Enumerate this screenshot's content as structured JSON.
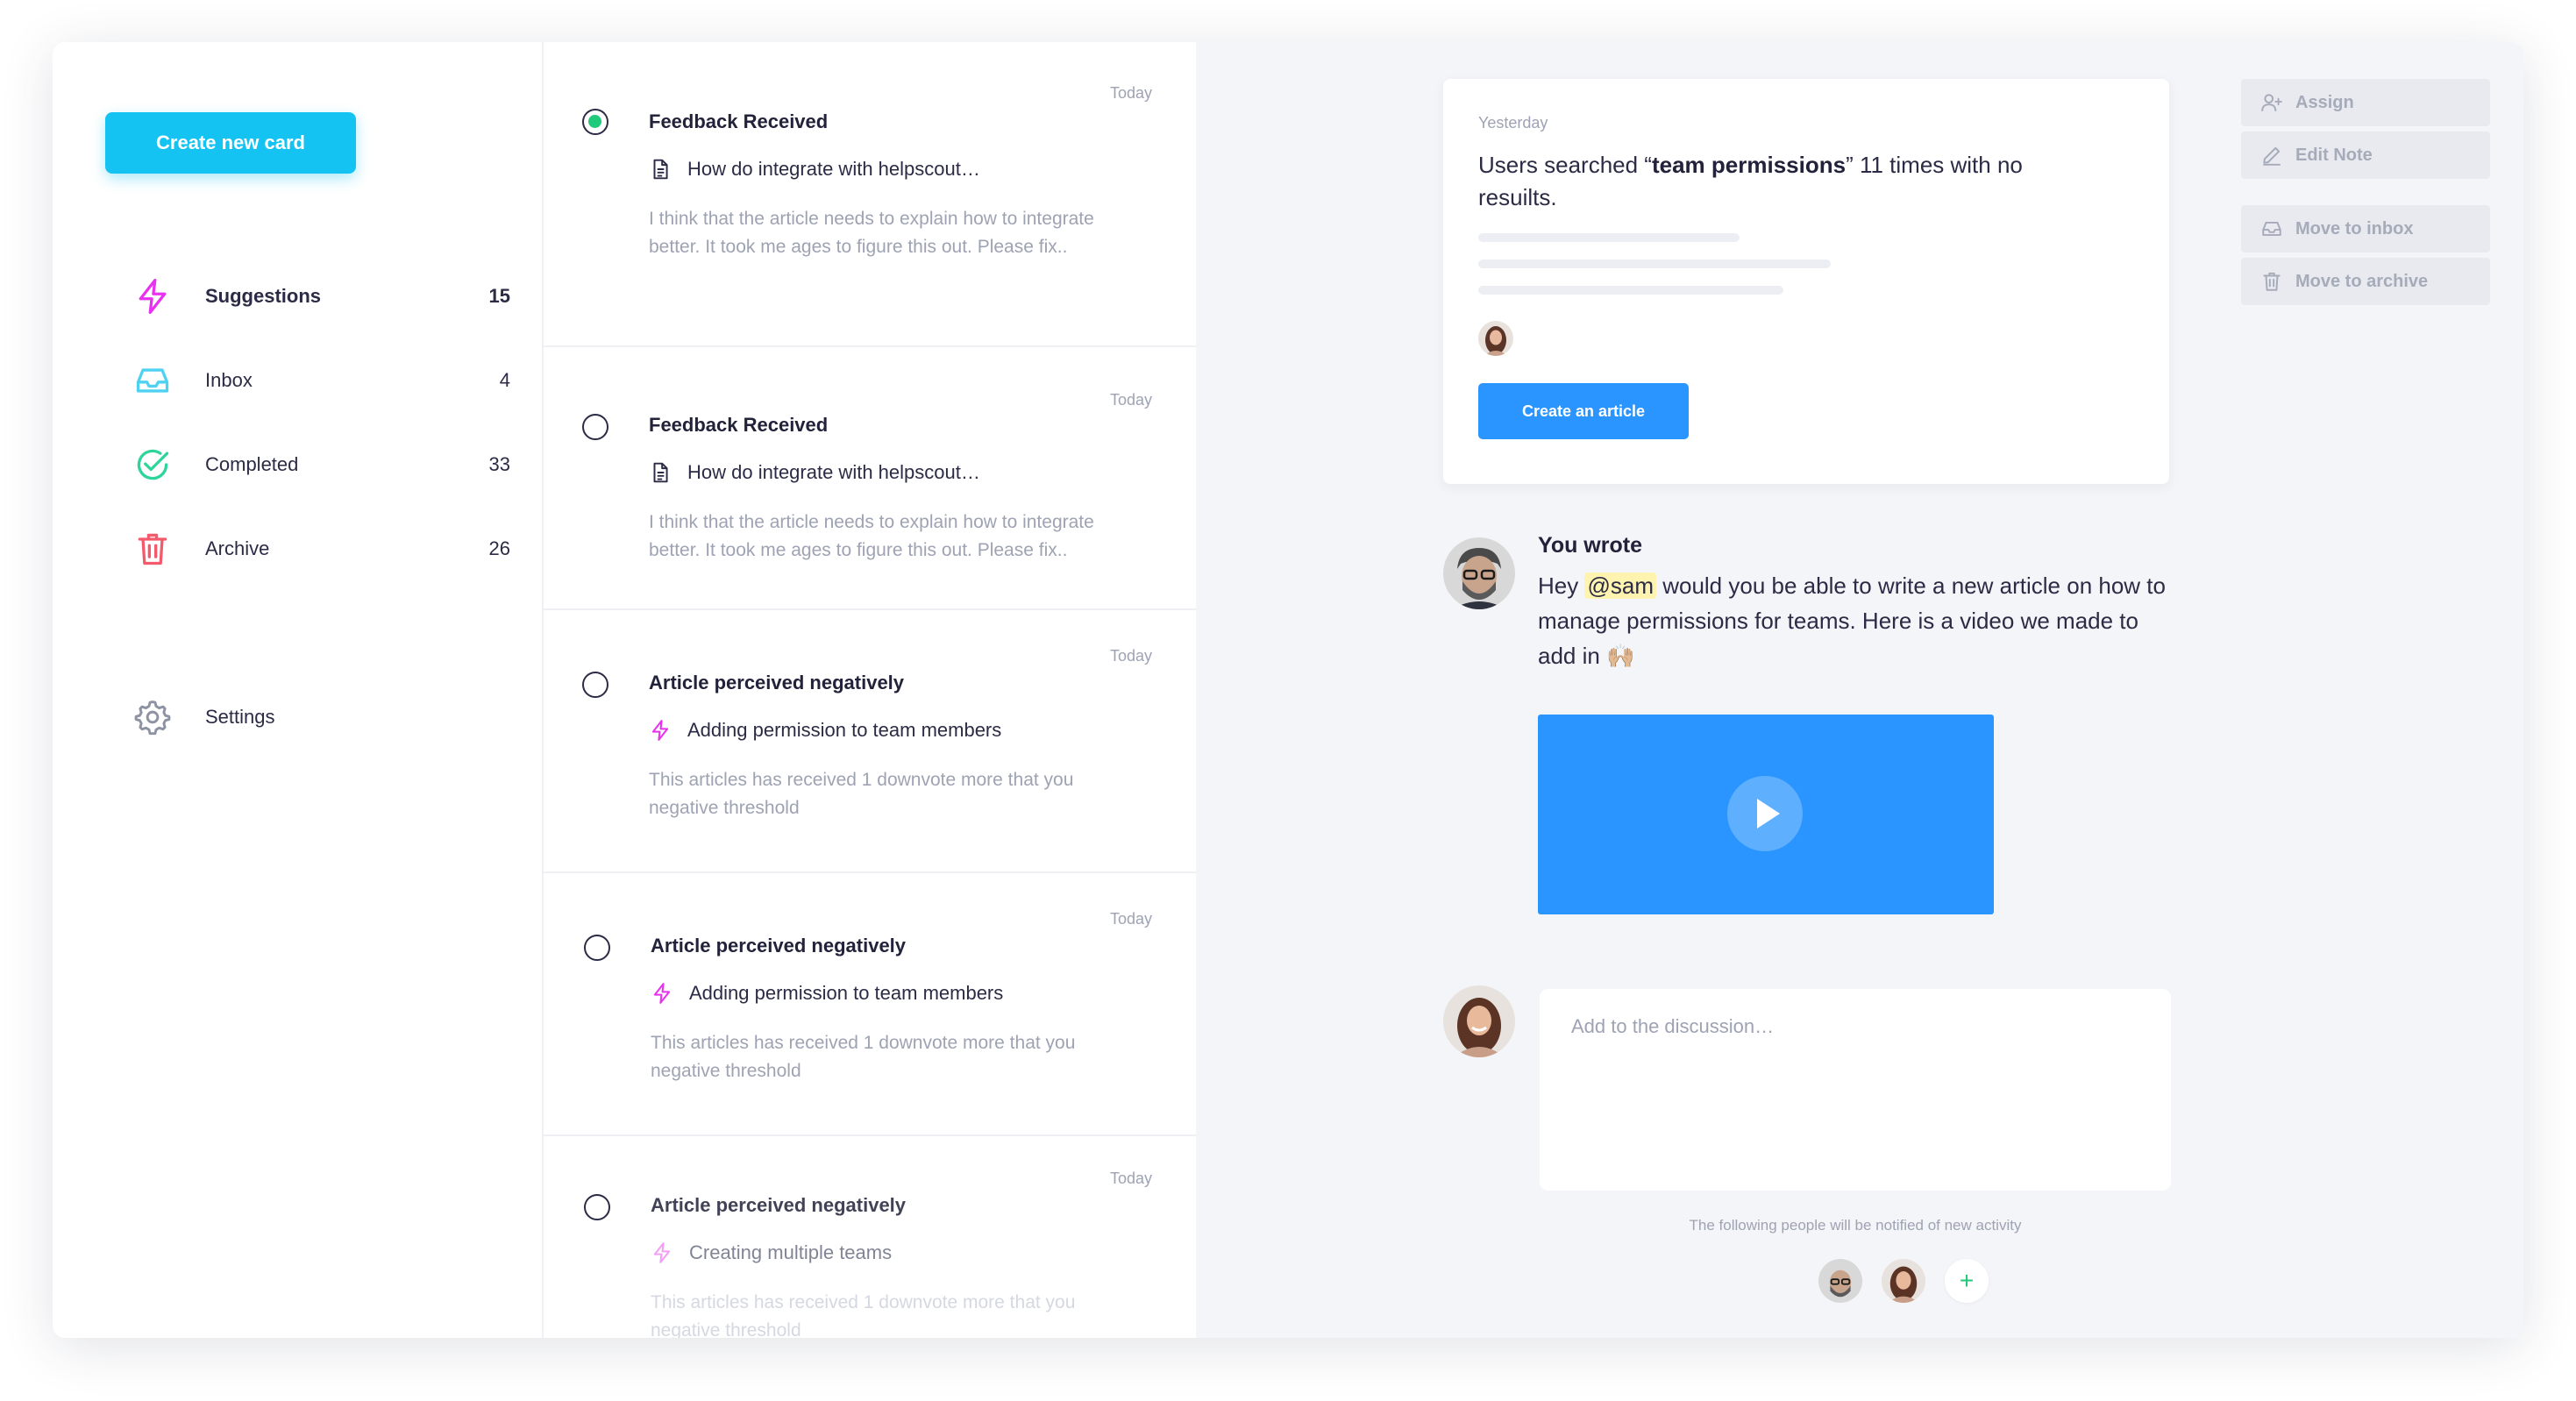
{
  "sidebar": {
    "create_label": "Create new card",
    "items": [
      {
        "label": "Suggestions",
        "count": "15",
        "icon": "bolt-icon",
        "color": "#e832f0"
      },
      {
        "label": "Inbox",
        "count": "4",
        "icon": "inbox-icon",
        "color": "#4fd2f2"
      },
      {
        "label": "Completed",
        "count": "33",
        "icon": "check-circle-icon",
        "color": "#2ed59b"
      },
      {
        "label": "Archive",
        "count": "26",
        "icon": "trash-icon",
        "color": "#f35a6b"
      }
    ],
    "settings_label": "Settings"
  },
  "cards": [
    {
      "date": "Today",
      "title": "Feedback Received",
      "sub": "How do integrate with helpscout…",
      "desc": "I think that the article needs to explain how to integrate better. It took me ages to figure this out. Please fix..",
      "icon": "document-icon",
      "checked": true
    },
    {
      "date": "Today",
      "title": "Feedback Received",
      "sub": "How do integrate with helpscout…",
      "desc": "I think that the article needs to explain how to integrate better. It took me ages to figure this out. Please fix..",
      "icon": "document-icon",
      "checked": false
    },
    {
      "date": "Today",
      "title": "Article perceived negatively",
      "sub": "Adding permission to team members",
      "desc": "This articles has received 1 downvote more that you negative threshold",
      "icon": "bolt-icon",
      "checked": false
    },
    {
      "date": "Today",
      "title": "Article perceived negatively",
      "sub": "Adding permission to team members",
      "desc": "This articles has received 1 downvote more that you negative threshold",
      "icon": "bolt-icon",
      "checked": false
    },
    {
      "date": "Today",
      "title": "Article perceived negatively",
      "sub": "Creating multiple teams",
      "desc": "This articles has received 1 downvote more that you negative threshold",
      "icon": "bolt-icon",
      "checked": false
    }
  ],
  "insight": {
    "date": "Yesterday",
    "text_pre": "Users searched “",
    "text_bold": "team permissions",
    "text_post": "” 11 times with no resuilts.",
    "button_label": "Create an article"
  },
  "message": {
    "author": "You wrote",
    "pre": "Hey ",
    "mention": "@sam",
    "post": " would you be able to write a new article on how to manage permissions for teams. Here is a video we made to add in 🙌🏼"
  },
  "discussion": {
    "placeholder": "Add to the discussion…",
    "notify_text": "The following people will be notified of new activity",
    "add_label": "+"
  },
  "actions": {
    "assign": "Assign",
    "edit_note": "Edit Note",
    "move_inbox": "Move to inbox",
    "move_archive": "Move to archive"
  }
}
